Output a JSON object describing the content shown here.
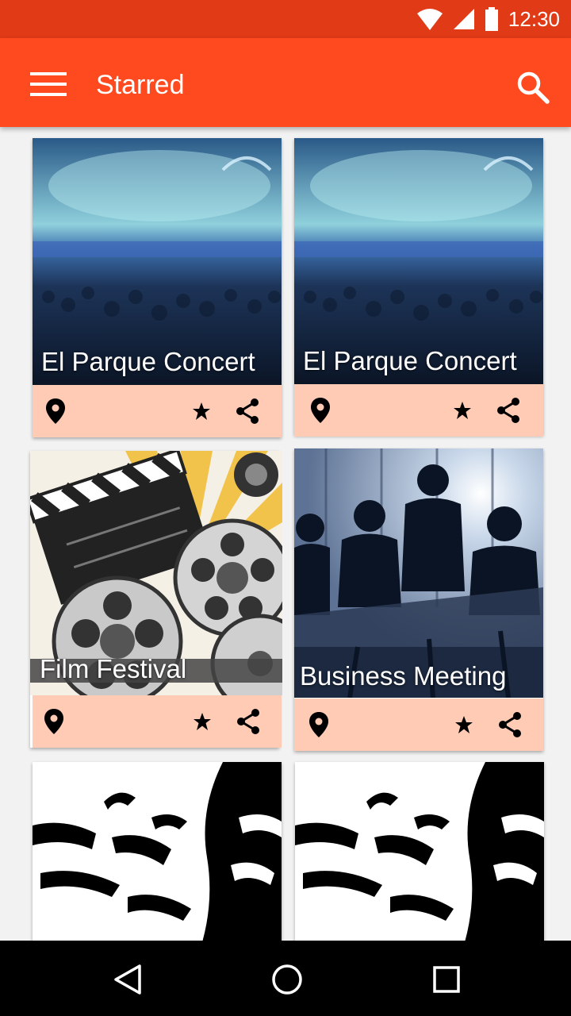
{
  "status_bar": {
    "time": "12:30",
    "icons": [
      "wifi-icon",
      "signal-icon",
      "battery-icon"
    ],
    "color": "#e03a16"
  },
  "app_bar": {
    "title": "Starred",
    "color": "#ff4a1f",
    "menu_icon": "hamburger-menu-icon",
    "search_icon": "search-icon"
  },
  "cards": [
    {
      "title": "El Parque Concert",
      "image": "concert-crowd-image"
    },
    {
      "title": "El Parque Concert",
      "image": "concert-crowd-image"
    },
    {
      "title": "Film Festival",
      "image": "film-reels-image"
    },
    {
      "title": "Business Meeting",
      "image": "business-meeting-image"
    },
    {
      "title": "",
      "image": "troll-face-image"
    },
    {
      "title": "",
      "image": "troll-face-image"
    }
  ],
  "card_actions": {
    "background": "#ffcbb5",
    "icons": [
      "location-pin-icon",
      "star-icon",
      "share-icon"
    ]
  },
  "nav_bar": {
    "icons": [
      "back-icon",
      "home-icon",
      "recents-icon"
    ]
  }
}
